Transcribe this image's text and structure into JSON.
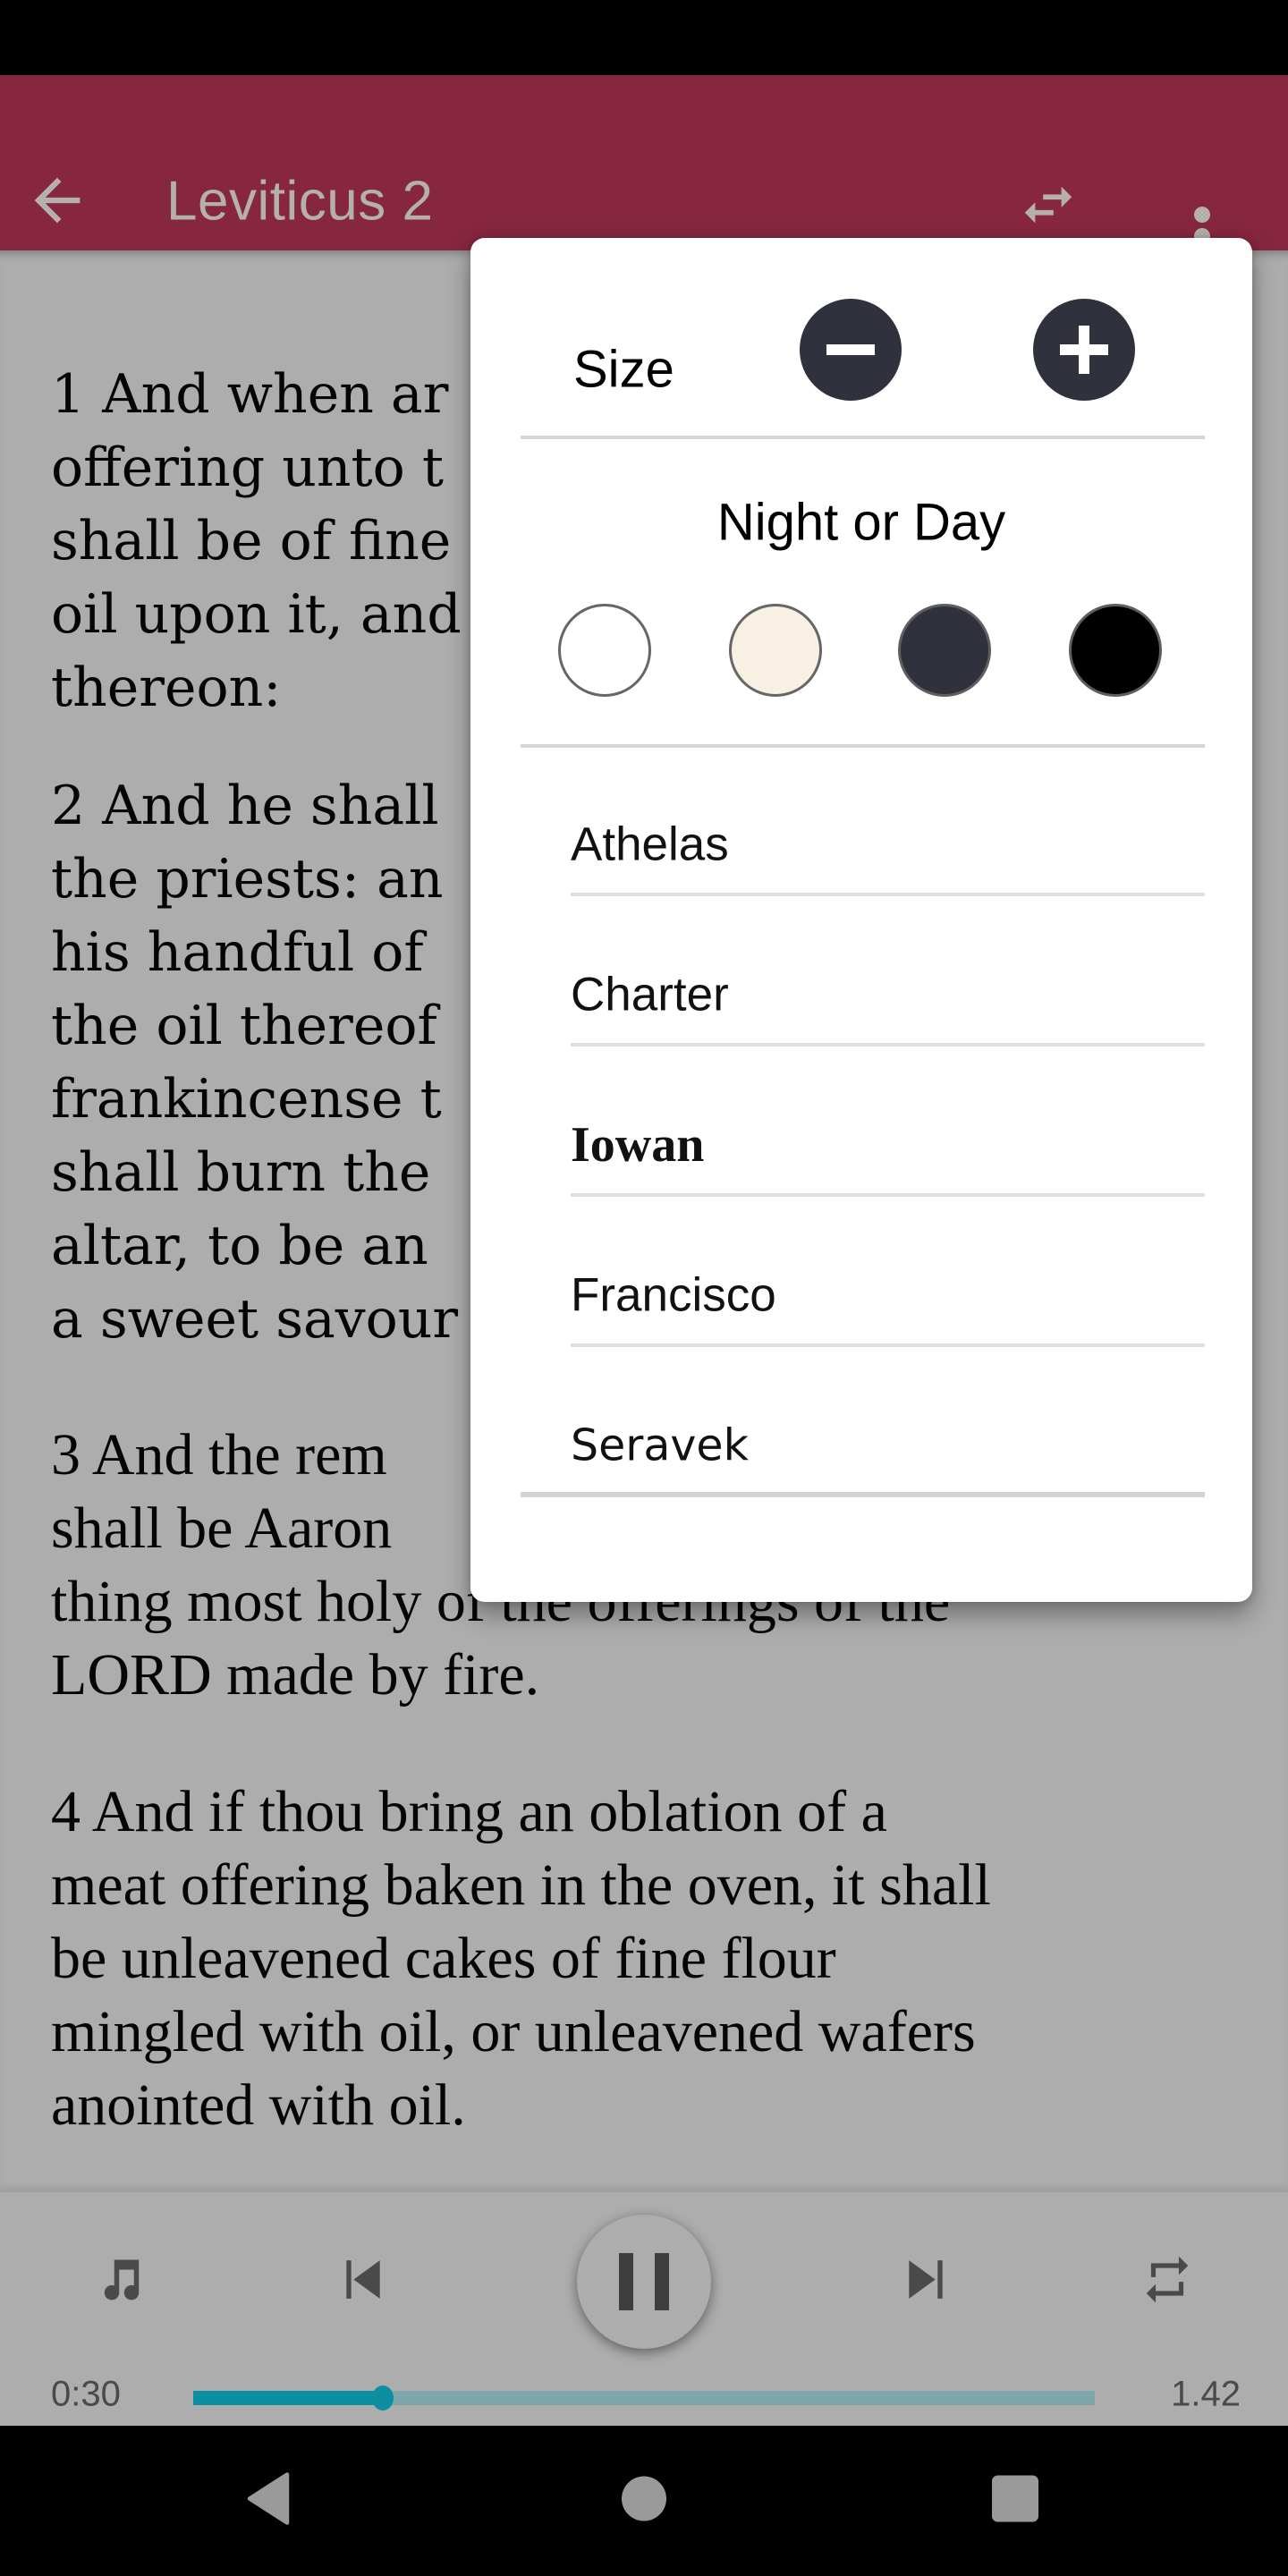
{
  "app_bar": {
    "title": "Leviticus 2",
    "back_icon": "arrow-left-icon",
    "swap_icon": "swap-horizontal-icon",
    "more_icon": "more-vertical-icon",
    "color": "#86263f"
  },
  "content": {
    "verses": [
      {
        "number": 1,
        "lines": [
          "1 And when ar",
          "offering unto t",
          "shall be of fine",
          "oil upon it, and",
          "thereon:"
        ]
      },
      {
        "number": 2,
        "lines": [
          "2 And he shall",
          "the priests: an",
          "his handful of",
          "the oil thereof",
          "frankincense t",
          "shall burn the",
          "altar, to be an",
          "a sweet savour"
        ]
      },
      {
        "number": 3,
        "lines": [
          "3 And the rem",
          "shall be Aaron",
          "thing most holy of the offerings of the",
          "LORD made by fire."
        ]
      },
      {
        "number": 4,
        "lines": [
          "4 And if thou bring an oblation of a",
          "meat offering baken in the oven, it shall",
          "be unleavened cakes of fine flour",
          "mingled with oil, or unleavened wafers",
          "anointed with oil."
        ]
      }
    ]
  },
  "settings_popup": {
    "size_label": "Size",
    "decrease_icon": "minus-circle-icon",
    "increase_icon": "plus-circle-icon",
    "theme_label": "Night or Day",
    "themes": [
      {
        "name": "white",
        "color": "#ffffff"
      },
      {
        "name": "sepia",
        "color": "#f9f0e4"
      },
      {
        "name": "dark-slate",
        "color": "#2f313d"
      },
      {
        "name": "black",
        "color": "#000000"
      }
    ],
    "fonts": [
      "Athelas",
      "Charter",
      "Iowan",
      "Francisco",
      "Seravek"
    ]
  },
  "player": {
    "current_time": "0:30",
    "total_time": "1.42",
    "progress": 0.21,
    "accent_color": "#0c8fa0",
    "icons": [
      "music-note-icon",
      "skip-previous-icon",
      "pause-icon",
      "skip-next-icon",
      "repeat-icon"
    ]
  },
  "nav_bar": {
    "icons": [
      "nav-back-icon",
      "nav-home-icon",
      "nav-recents-icon"
    ]
  }
}
